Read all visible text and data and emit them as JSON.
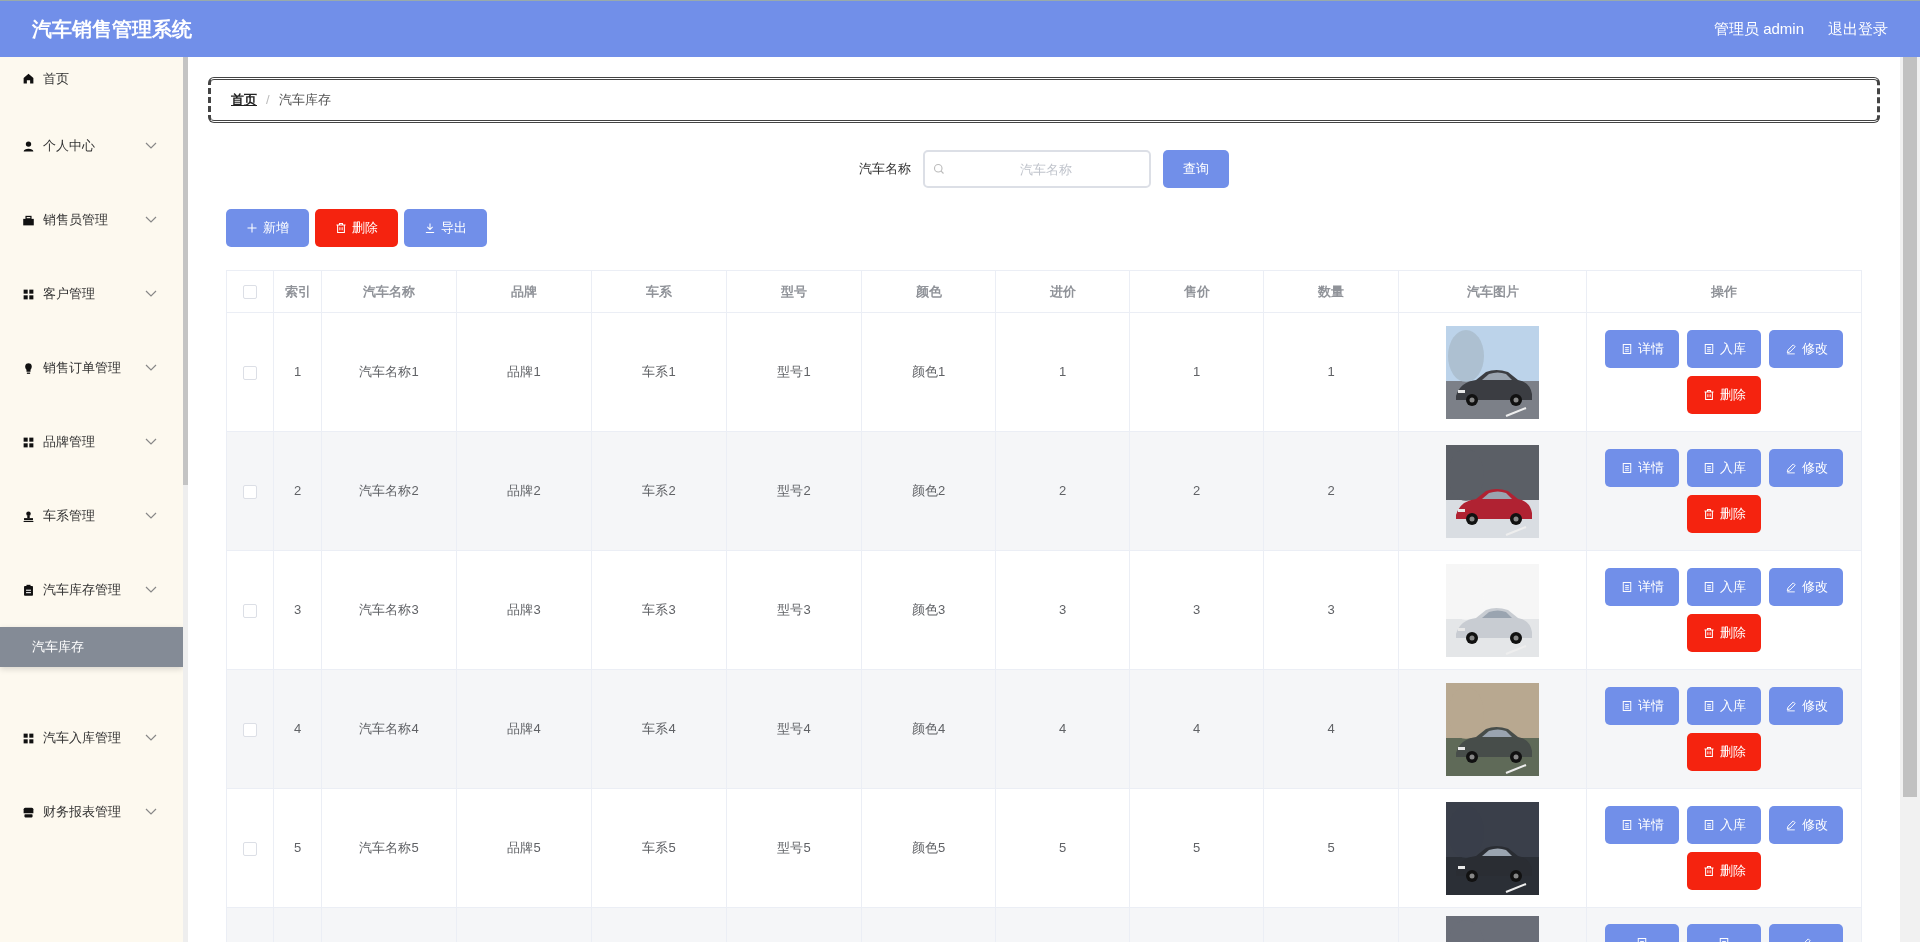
{
  "header": {
    "title": "汽车销售管理系统",
    "user": "管理员 admin",
    "logout": "退出登录"
  },
  "sidebar": {
    "items": [
      {
        "label": "首页",
        "kind": "link"
      },
      {
        "label": "个人中心",
        "kind": "menu"
      },
      {
        "label": "销售员管理",
        "kind": "menu"
      },
      {
        "label": "客户管理",
        "kind": "menu"
      },
      {
        "label": "销售订单管理",
        "kind": "menu"
      },
      {
        "label": "品牌管理",
        "kind": "menu"
      },
      {
        "label": "车系管理",
        "kind": "menu"
      },
      {
        "label": "汽车库存管理",
        "kind": "menu",
        "children": [
          {
            "label": "汽车库存",
            "selected": true
          }
        ]
      },
      {
        "label": "汽车入库管理",
        "kind": "menu"
      },
      {
        "label": "财务报表管理",
        "kind": "menu"
      }
    ]
  },
  "breadcrumb": {
    "items": [
      "首页",
      "汽车库存"
    ],
    "separator": "/"
  },
  "search": {
    "label": "汽车名称",
    "placeholder": "汽车名称",
    "button": "查询"
  },
  "toolbar": [
    {
      "label": "新增",
      "kind": "add"
    },
    {
      "label": "删除",
      "kind": "delete"
    },
    {
      "label": "导出",
      "kind": "export"
    }
  ],
  "table": {
    "select_all": {
      "checked": false
    },
    "columns": [
      "索引",
      "汽车名称",
      "品牌",
      "车系",
      "型号",
      "颜色",
      "进价",
      "售价",
      "数量",
      "汽车图片",
      "操作"
    ],
    "rows": [
      {
        "checked": false,
        "cells": [
          "1",
          "汽车名称1",
          "品牌1",
          "车系1",
          "型号1",
          "颜色1",
          "1",
          "1",
          "1"
        ],
        "image": {
          "kind": "picture"
        },
        "actions": [
          {
            "label": "详情",
            "kind": "detail"
          },
          {
            "label": "入库",
            "kind": "stock"
          },
          {
            "label": "修改",
            "kind": "edit"
          },
          {
            "label": "删除",
            "kind": "delete"
          }
        ]
      },
      {
        "checked": false,
        "cells": [
          "2",
          "汽车名称2",
          "品牌2",
          "车系2",
          "型号2",
          "颜色2",
          "2",
          "2",
          "2"
        ],
        "image": {
          "kind": "picture"
        },
        "actions": [
          {
            "label": "详情",
            "kind": "detail"
          },
          {
            "label": "入库",
            "kind": "stock"
          },
          {
            "label": "修改",
            "kind": "edit"
          },
          {
            "label": "删除",
            "kind": "delete"
          }
        ]
      },
      {
        "checked": false,
        "cells": [
          "3",
          "汽车名称3",
          "品牌3",
          "车系3",
          "型号3",
          "颜色3",
          "3",
          "3",
          "3"
        ],
        "image": {
          "kind": "picture"
        },
        "actions": [
          {
            "label": "详情",
            "kind": "detail"
          },
          {
            "label": "入库",
            "kind": "stock"
          },
          {
            "label": "修改",
            "kind": "edit"
          },
          {
            "label": "删除",
            "kind": "delete"
          }
        ]
      },
      {
        "checked": false,
        "cells": [
          "4",
          "汽车名称4",
          "品牌4",
          "车系4",
          "型号4",
          "颜色4",
          "4",
          "4",
          "4"
        ],
        "image": {
          "kind": "picture"
        },
        "actions": [
          {
            "label": "详情",
            "kind": "detail"
          },
          {
            "label": "入库",
            "kind": "stock"
          },
          {
            "label": "修改",
            "kind": "edit"
          },
          {
            "label": "删除",
            "kind": "delete"
          }
        ]
      },
      {
        "checked": false,
        "cells": [
          "5",
          "汽车名称5",
          "品牌5",
          "车系5",
          "型号5",
          "颜色5",
          "5",
          "5",
          "5"
        ],
        "image": {
          "kind": "picture"
        },
        "actions": [
          {
            "label": "详情",
            "kind": "detail"
          },
          {
            "label": "入库",
            "kind": "stock"
          },
          {
            "label": "修改",
            "kind": "edit"
          },
          {
            "label": "删除",
            "kind": "delete"
          }
        ]
      },
      {
        "image": {
          "kind": "picture"
        },
        "actions": [
          {
            "kind": "detail"
          },
          {
            "kind": "stock"
          },
          {
            "kind": "edit"
          }
        ]
      }
    ]
  }
}
